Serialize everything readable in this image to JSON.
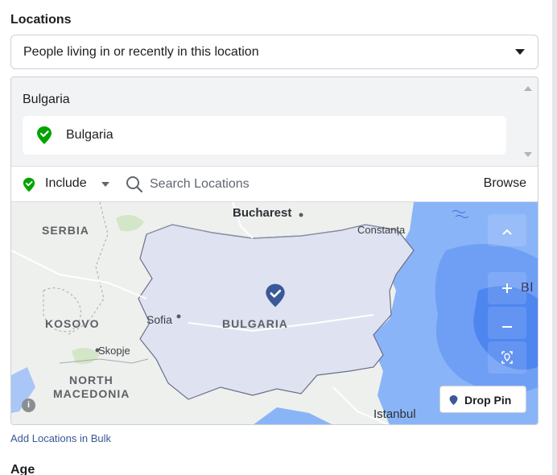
{
  "section": {
    "title": "Locations"
  },
  "dropdown": {
    "value": "People living in or recently in this location"
  },
  "selected": {
    "country_title": "Bulgaria",
    "chip_label": "Bulgaria"
  },
  "search": {
    "include_label": "Include",
    "placeholder": "Search Locations",
    "browse_label": "Browse"
  },
  "map": {
    "labels": {
      "serbia": "SERBIA",
      "kosovo": "KOSOVO",
      "north": "NORTH",
      "macedonia": "MACEDONIA",
      "bulgaria": "BULGARIA",
      "bl": "Bl"
    },
    "cities": {
      "bucharest": "Bucharest",
      "constanta": "Constanța",
      "sofia": "Sofia",
      "skopje": "Skopje",
      "istanbul": "Istanbul"
    },
    "drop_pin_label": "Drop Pin",
    "info": "i",
    "colors": {
      "land": "#eef0ed",
      "selected_country": "#dfe3f1",
      "sea": "#8ab4f8",
      "sea_deep": "#4e86f0",
      "pin": "#3b5998",
      "green": "#00a400"
    }
  },
  "footer": {
    "bulk_link": "Add Locations in Bulk",
    "next_section_title": "Age"
  }
}
